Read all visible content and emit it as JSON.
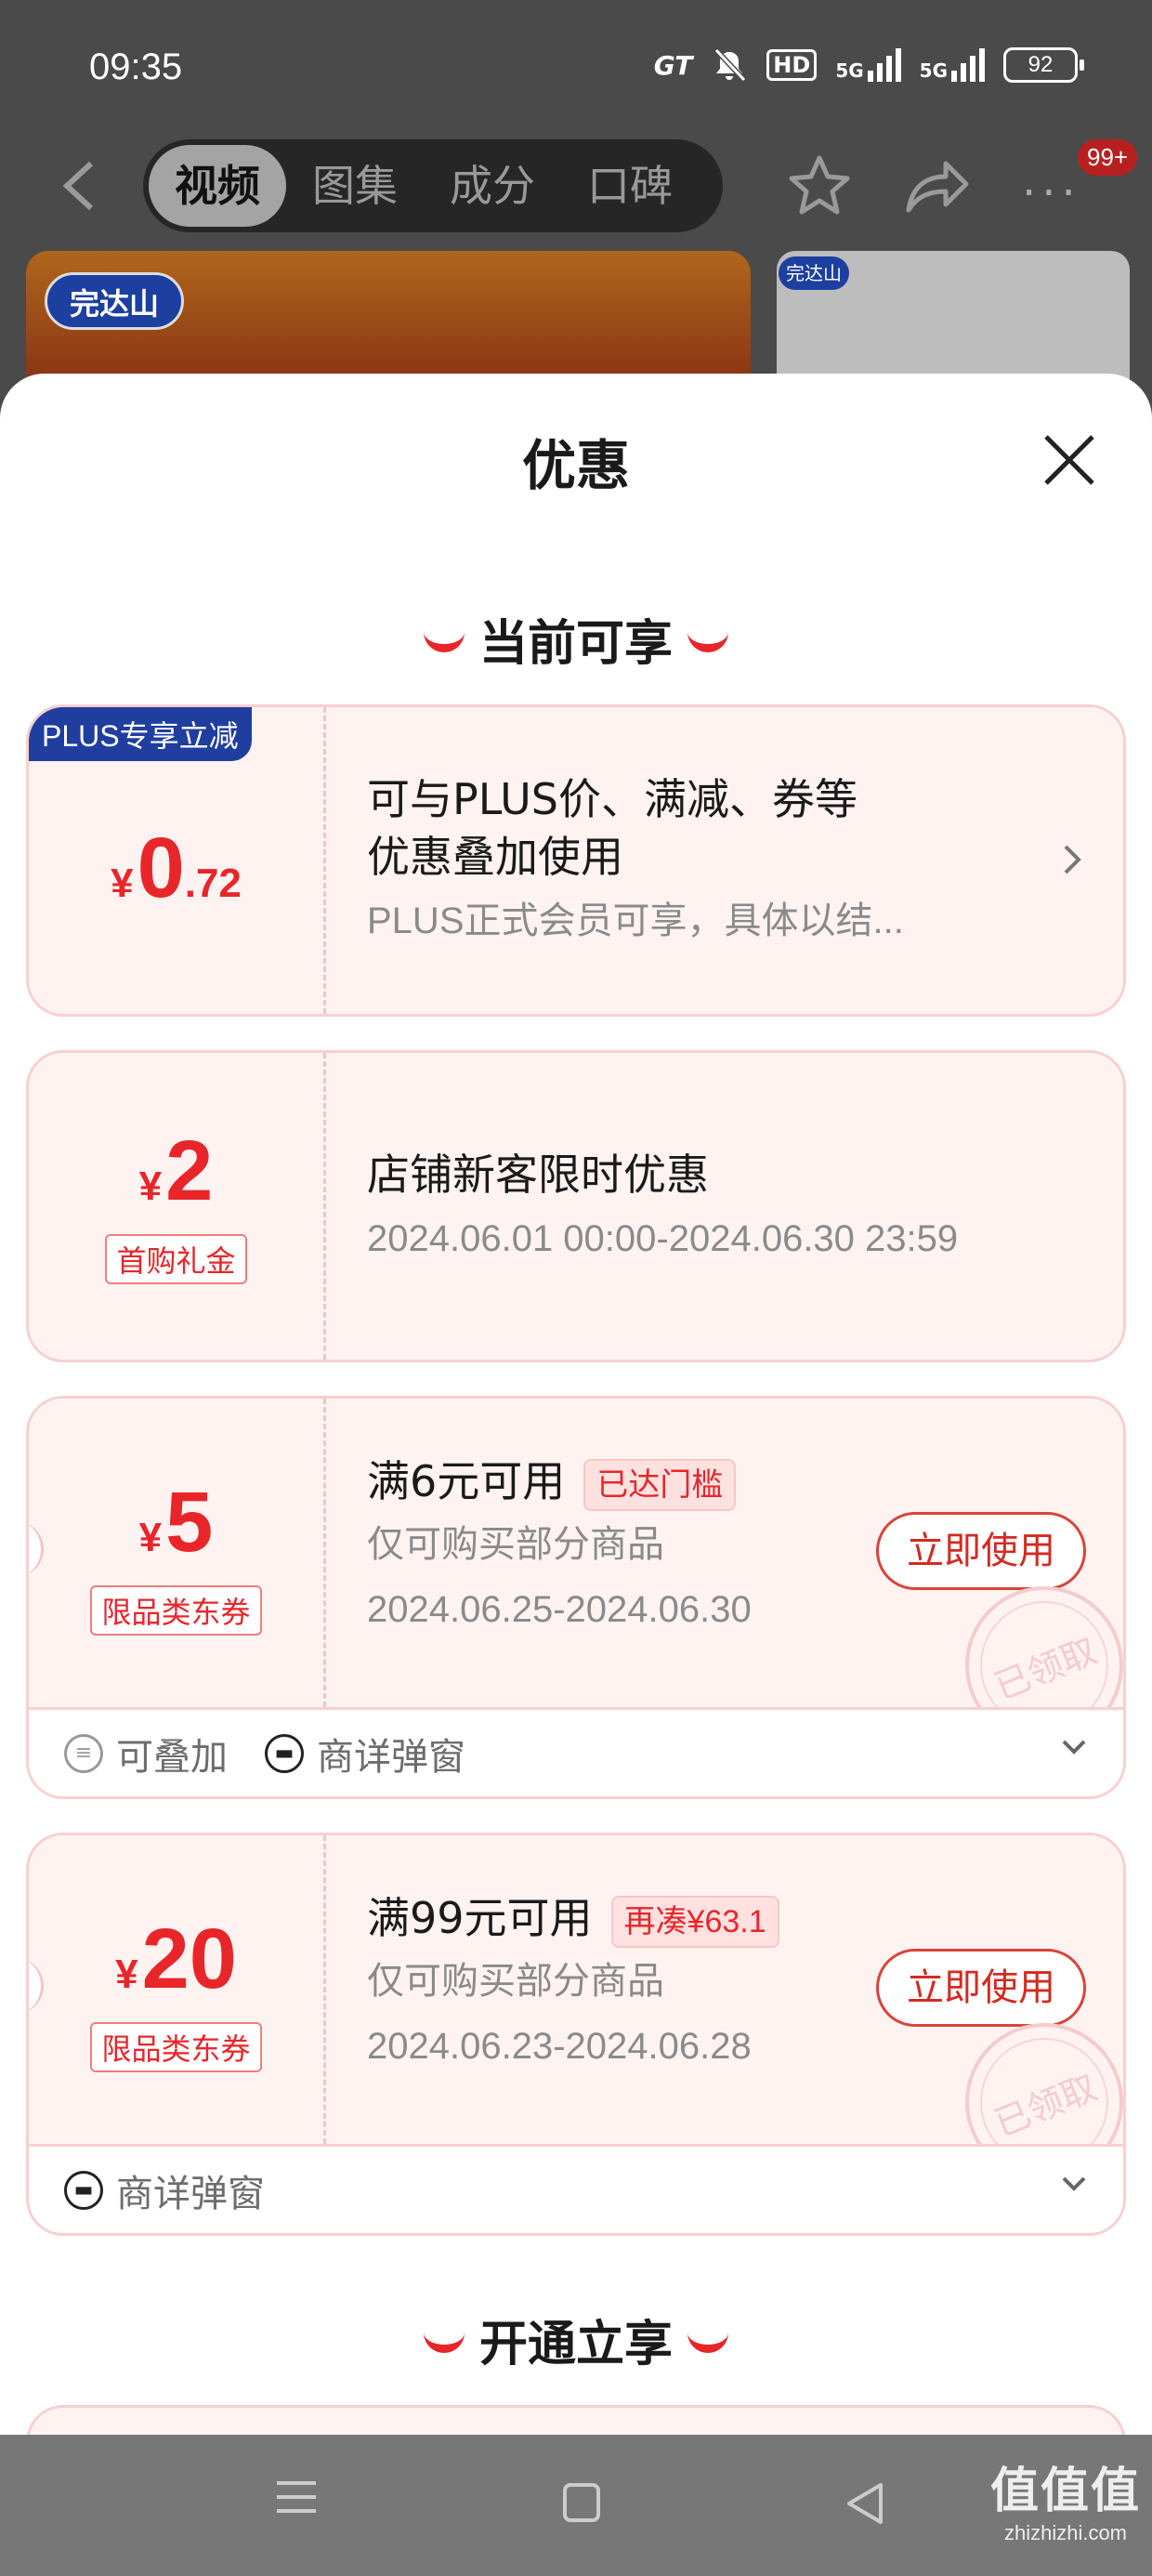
{
  "status_bar": {
    "time": "09:35",
    "icons": [
      "gt-icon",
      "mute-icon",
      "hd-icon",
      "5g-signal-icon",
      "5g-signal-icon"
    ],
    "hd_label": "HD",
    "net1": "5G",
    "net2": "5G",
    "battery": "92"
  },
  "top_nav": {
    "tabs": [
      {
        "label": "视频",
        "active": true
      },
      {
        "label": "图集",
        "active": false
      },
      {
        "label": "成分",
        "active": false
      },
      {
        "label": "口碑",
        "active": false
      }
    ],
    "more_badge": "99+"
  },
  "background": {
    "brand_logo": "完达山"
  },
  "sheet": {
    "title": "优惠",
    "section_current": "当前可享",
    "section_open": "开通立享",
    "coupons": [
      {
        "badge": "PLUS专享立减",
        "currency": "¥",
        "amount_int": "0",
        "amount_dec": ".72",
        "line1": "可与PLUS价、满减、券等",
        "line2": "优惠叠加使用",
        "sub": "PLUS正式会员可享，具体以结..."
      },
      {
        "currency": "¥",
        "amount": "2",
        "tag": "首购礼金",
        "title": "店铺新客限时优惠",
        "date": "2024.06.01 00:00-2024.06.30 23:59"
      },
      {
        "currency": "¥",
        "amount": "5",
        "tag": "限品类东券",
        "title": "满6元可用",
        "pill": "已达门槛",
        "sub": "仅可购买部分商品",
        "date": "2024.06.25-2024.06.30",
        "button": "立即使用",
        "stamp": "已领取",
        "foot": [
          "可叠加",
          "商详弹窗"
        ]
      },
      {
        "currency": "¥",
        "amount": "20",
        "tag": "限品类东券",
        "title": "满99元可用",
        "pill": "再凑¥63.1",
        "sub": "仅可购买部分商品",
        "date": "2024.06.23-2024.06.28",
        "button": "立即使用",
        "stamp": "已领取",
        "foot": [
          "商详弹窗"
        ]
      }
    ]
  },
  "watermark": {
    "line1": "值值值",
    "line2": "zhizhizhi.com"
  }
}
